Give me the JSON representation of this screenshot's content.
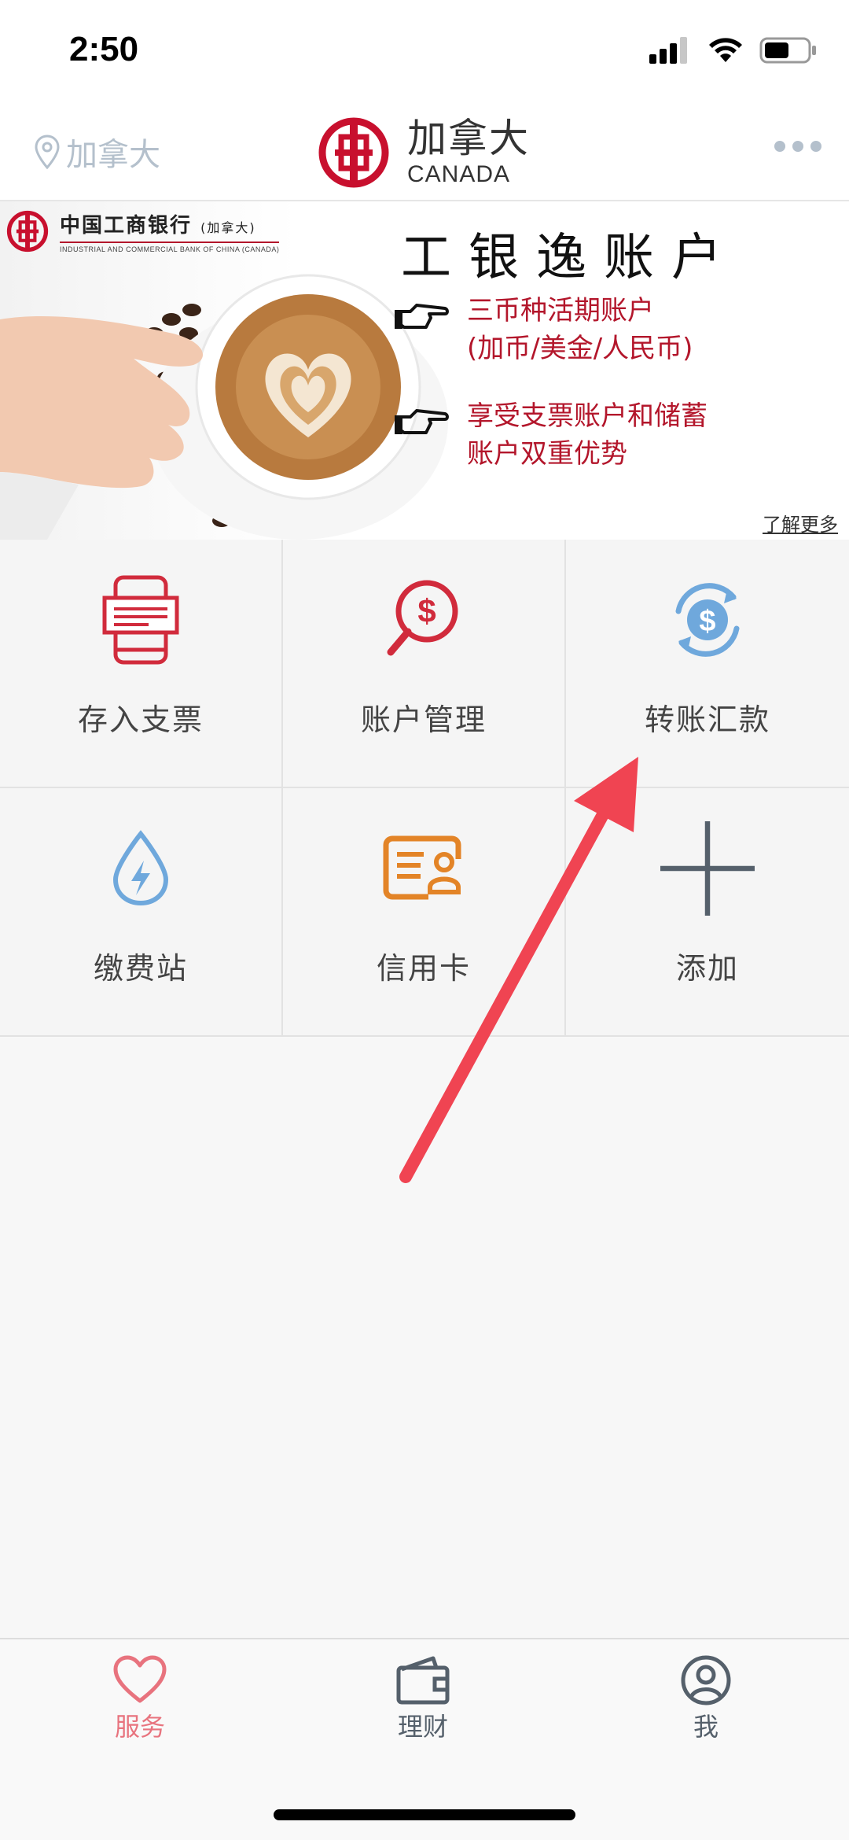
{
  "status_bar": {
    "time": "2:50"
  },
  "header": {
    "location": "加拿大",
    "brand_cn": "加拿大",
    "brand_en": "CANADA"
  },
  "banner": {
    "bank_name_cn": "中国工商银行",
    "bank_name_region": "(加拿大)",
    "bank_name_en": "INDUSTRIAL AND COMMERCIAL BANK OF CHINA (CANADA)",
    "title": "工银逸账户",
    "feature1_line1": "三币种活期账户",
    "feature1_line2": "(加币/美金/人民币)",
    "feature2_line1": "享受支票账户和储蓄",
    "feature2_line2": "账户双重优势",
    "learn_more": "了解更多"
  },
  "grid": {
    "items": [
      {
        "label": "存入支票",
        "icon": "cheque-deposit-icon",
        "color": "#d12b3c"
      },
      {
        "label": "账户管理",
        "icon": "dollar-search-icon",
        "color": "#d12b3c"
      },
      {
        "label": "转账汇款",
        "icon": "dollar-transfer-icon",
        "color": "#6fa8dc"
      },
      {
        "label": "缴费站",
        "icon": "water-drop-bolt-icon",
        "color": "#6fa8dc"
      },
      {
        "label": "信用卡",
        "icon": "credit-card-icon",
        "color": "#e38427"
      },
      {
        "label": "添加",
        "icon": "plus-icon",
        "color": "#55606b"
      }
    ]
  },
  "tabbar": {
    "service": "服务",
    "finance": "理财",
    "me": "我",
    "active_color": "#e8737e",
    "inactive_color": "#55606b"
  },
  "colors": {
    "brand_red": "#c8102e",
    "arrow_red": "#f04452"
  }
}
